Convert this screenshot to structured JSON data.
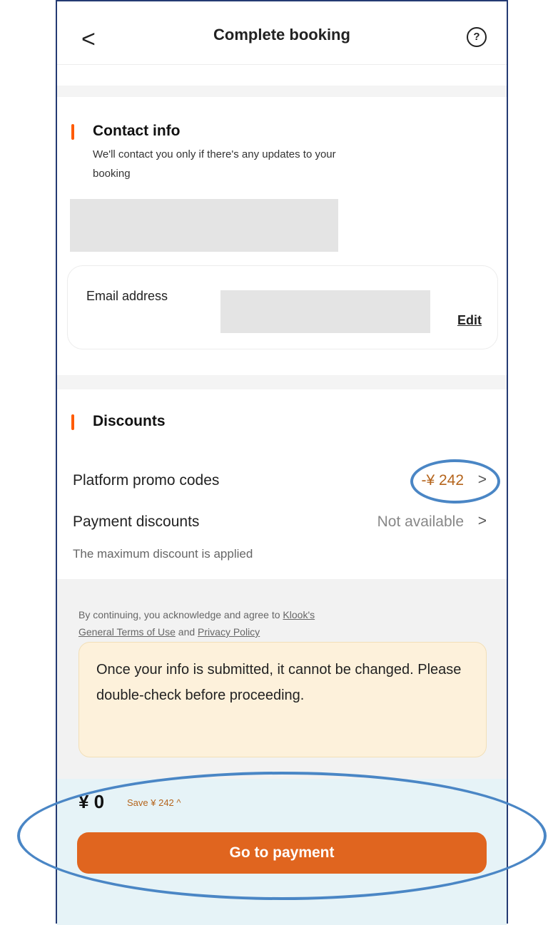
{
  "header": {
    "back_icon": "chevron-left-icon",
    "back_glyph": "<",
    "title": "Complete booking",
    "help_icon": "help-circle-icon",
    "help_glyph": "?"
  },
  "contact": {
    "title": "Contact info",
    "subtitle_line1": "We'll contact you only if there's any updates to your",
    "subtitle_line2": "booking",
    "email_label": "Email address",
    "edit_label": "Edit"
  },
  "discounts": {
    "title": "Discounts",
    "promo_label": "Platform promo codes",
    "promo_value": "-¥ 242",
    "payment_label": "Payment discounts",
    "payment_value": "Not available",
    "chevron_glyph": ">",
    "note": "The maximum discount is applied"
  },
  "terms": {
    "prefix": "By continuing, you acknowledge and agree to ",
    "link_klook": "Klook's",
    "link_terms": "General Terms of Use",
    "and": " and ",
    "link_privacy": "Privacy Policy"
  },
  "warning": {
    "text": "Once your info is submitted, it cannot be changed. Please double-check before proceeding."
  },
  "footer": {
    "price": "¥ 0",
    "save": "Save ¥ 242 ^",
    "pay_button": "Go to payment"
  },
  "colors": {
    "accent": "#ff5b00",
    "button": "#e0651f",
    "annotation": "#4a86c5"
  }
}
